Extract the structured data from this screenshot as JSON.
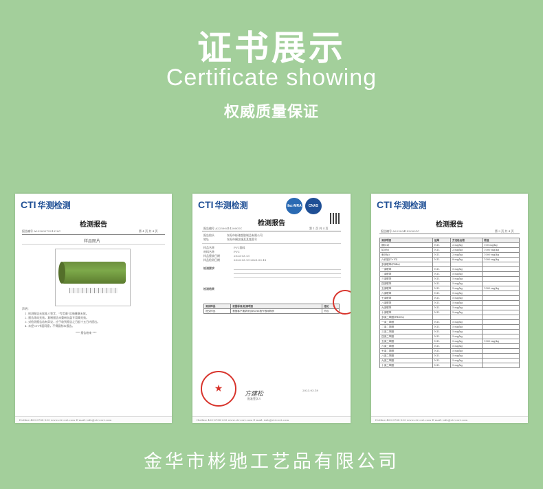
{
  "header": {
    "title": "证书展示",
    "subtitle": "Certificate showing",
    "tagline": "权威质量保证"
  },
  "colors": {
    "background": "#a3cf9b",
    "brand_blue": "#1f4f95",
    "stamp_red": "#d8342c"
  },
  "certificates": [
    {
      "logo_text": "CTI",
      "logo_cn": "华测检测",
      "title": "检测报告",
      "report_no": "报告编号  A2230027521910C",
      "page": "第 4 页  共 4 页",
      "section": "样品图片",
      "notes_head": "声明：",
      "notes": [
        "1. 检测报告无批准人签字、\"专用章\"及骑缝章无效。",
        "2. 报告改动无效，复制报告未重新加盖专用章无效。",
        "3. 对检测报告若有异议，应于收到报告之日起十五日内提出。",
        "4. 未经CTI书面同意，不得复制本报告。"
      ],
      "end_text": "*** 报告结束 ***",
      "footer": "Hotline 400-6788-333   www.cti-cert.com   E-mail: info@cti-cert.com"
    },
    {
      "logo_text": "CTI",
      "logo_cn": "华测检测",
      "badge_left": "ilac-MRA",
      "badge_right": "CNAS",
      "title": "检测报告",
      "report_no": "报告编号  A2230041420001C",
      "page": "第 1 页  共 4 页",
      "fields": [
        [
          "报告抬头",
          "东阳市彬驰塑胶制品有限公司"
        ],
        [
          "地址",
          "东阳市横店镇某某路某号"
        ]
      ],
      "sample_fields": [
        [
          "样品名称",
          "PVC面料"
        ],
        [
          "材料名称",
          "PVC"
        ],
        [
          "样品接收日期",
          "2023.03.13"
        ],
        [
          "样品检测日期",
          "2023.03.13-2023.03.18"
        ]
      ],
      "test_item_label": "检测要求",
      "conclusion_label": "检测结果",
      "table_headers": [
        "测试样品",
        "依据标准/检测项目",
        "结论"
      ],
      "table_row": [
        "提交样品",
        "根据客户要求测试RoHS指令限用物质",
        "符合"
      ],
      "signer": "方建松",
      "approver_label": "批准签字人",
      "date": "2023.03.18",
      "footer": "Hotline 400-6788-333   www.cti-cert.com   E-mail: info@cti-cert.com"
    },
    {
      "logo_text": "CTI",
      "logo_cn": "华测检测",
      "title": "检测报告",
      "report_no": "报告编号  A2230041420001C",
      "page": "第 3 页  共 4 页",
      "table_headers": [
        "测试项目",
        "结果",
        "方法检出限",
        "限值"
      ],
      "rows": [
        [
          "镉(Cd)",
          "N.D.",
          "2 mg/kg",
          "100 mg/kg"
        ],
        [
          "铅(Pb)",
          "N.D.",
          "2 mg/kg",
          "1000 mg/kg"
        ],
        [
          "汞(Hg)",
          "N.D.",
          "2 mg/kg",
          "1000 mg/kg"
        ],
        [
          "六价铬(Cr VI)",
          "N.D.",
          "8 mg/kg",
          "1000 mg/kg"
        ],
        [
          "多溴联苯(PBBs)",
          "",
          "",
          ""
        ],
        [
          "一溴联苯",
          "N.D.",
          "5 mg/kg",
          ""
        ],
        [
          "二溴联苯",
          "N.D.",
          "5 mg/kg",
          ""
        ],
        [
          "三溴联苯",
          "N.D.",
          "5 mg/kg",
          ""
        ],
        [
          "四溴联苯",
          "N.D.",
          "5 mg/kg",
          ""
        ],
        [
          "五溴联苯",
          "N.D.",
          "5 mg/kg",
          "1000 mg/kg"
        ],
        [
          "六溴联苯",
          "N.D.",
          "5 mg/kg",
          ""
        ],
        [
          "七溴联苯",
          "N.D.",
          "5 mg/kg",
          ""
        ],
        [
          "八溴联苯",
          "N.D.",
          "5 mg/kg",
          ""
        ],
        [
          "九溴联苯",
          "N.D.",
          "5 mg/kg",
          ""
        ],
        [
          "十溴联苯",
          "N.D.",
          "5 mg/kg",
          ""
        ],
        [
          "多溴二苯醚(PBDEs)",
          "",
          "",
          ""
        ],
        [
          "一溴二苯醚",
          "N.D.",
          "5 mg/kg",
          ""
        ],
        [
          "二溴二苯醚",
          "N.D.",
          "5 mg/kg",
          ""
        ],
        [
          "三溴二苯醚",
          "N.D.",
          "5 mg/kg",
          ""
        ],
        [
          "四溴二苯醚",
          "N.D.",
          "5 mg/kg",
          ""
        ],
        [
          "五溴二苯醚",
          "N.D.",
          "5 mg/kg",
          "1000 mg/kg"
        ],
        [
          "六溴二苯醚",
          "N.D.",
          "5 mg/kg",
          ""
        ],
        [
          "七溴二苯醚",
          "N.D.",
          "5 mg/kg",
          ""
        ],
        [
          "八溴二苯醚",
          "N.D.",
          "5 mg/kg",
          ""
        ],
        [
          "九溴二苯醚",
          "N.D.",
          "5 mg/kg",
          ""
        ],
        [
          "十溴二苯醚",
          "N.D.",
          "5 mg/kg",
          ""
        ]
      ],
      "footer": "Hotline 400-6788-333   www.cti-cert.com   E-mail: info@cti-cert.com"
    }
  ],
  "company_name": "金华市彬驰工艺品有限公司"
}
